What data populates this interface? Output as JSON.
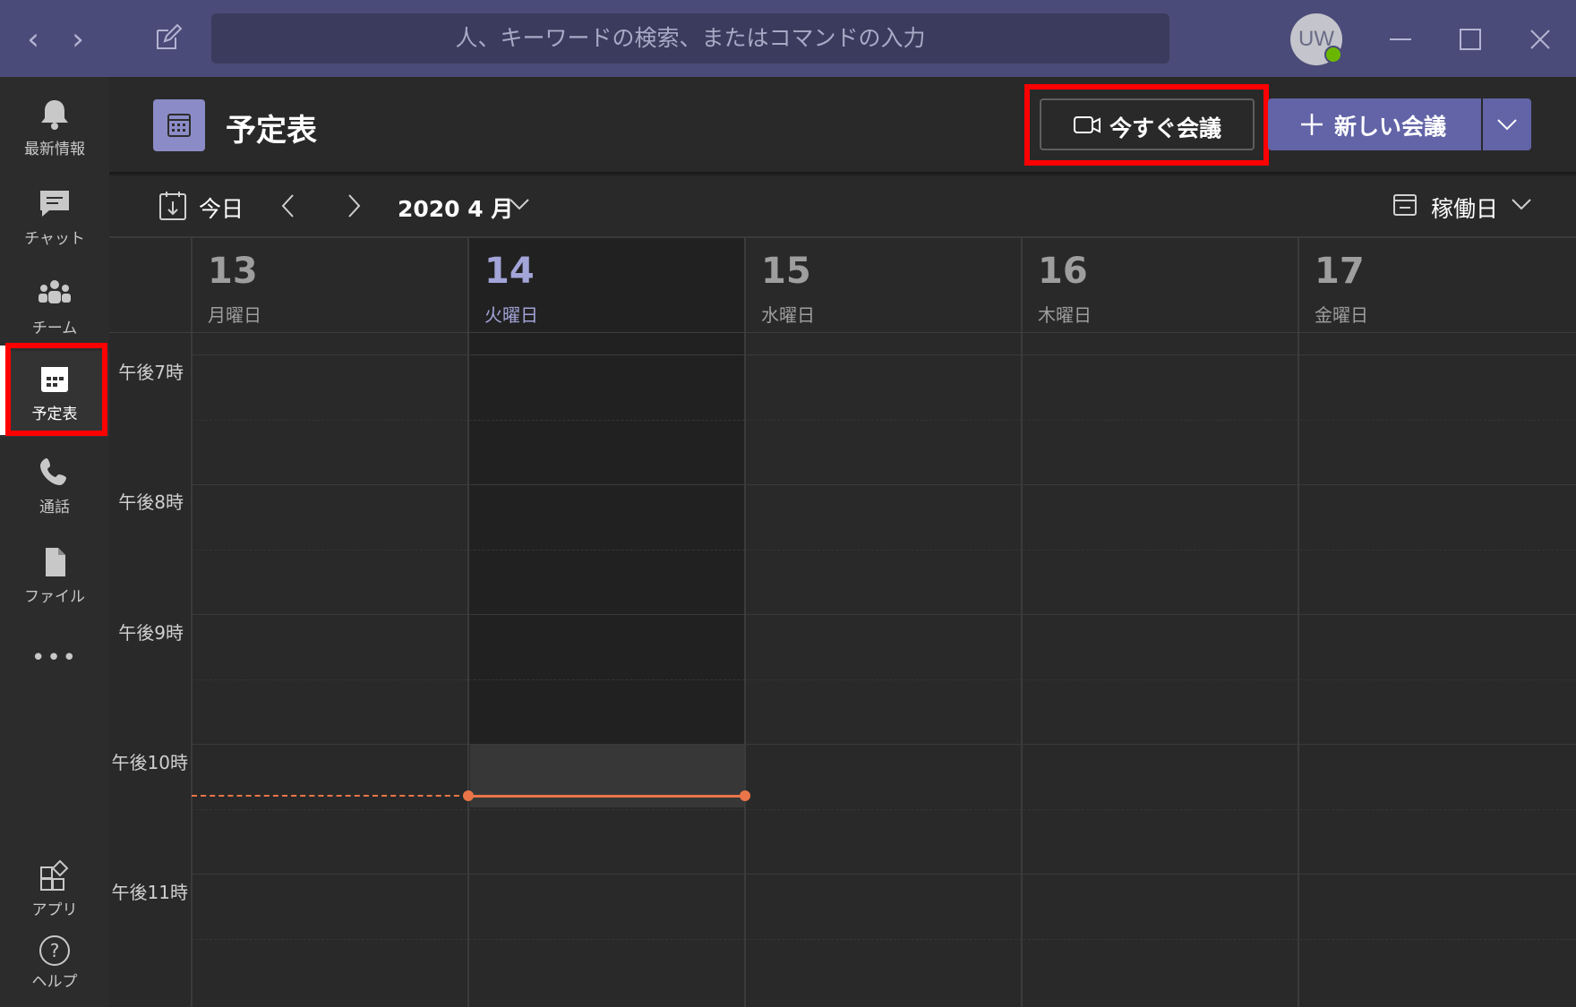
{
  "titlebar": {
    "search_placeholder": "人、キーワードの検索、またはコマンドの入力",
    "avatar_initials": "UW",
    "presence_color": "#6bb700"
  },
  "rail": {
    "items": [
      {
        "label": "最新情報",
        "icon": "bell-icon"
      },
      {
        "label": "チャット",
        "icon": "chat-icon"
      },
      {
        "label": "チーム",
        "icon": "teams-icon"
      },
      {
        "label": "予定表",
        "icon": "calendar-icon",
        "active": true
      },
      {
        "label": "通話",
        "icon": "phone-icon"
      },
      {
        "label": "ファイル",
        "icon": "file-icon"
      },
      {
        "label": "アプリ",
        "icon": "apps-icon"
      },
      {
        "label": "ヘルプ",
        "icon": "help-icon"
      }
    ],
    "more_label": "•••"
  },
  "header": {
    "title": "予定表",
    "meet_now_label": "今すぐ会議",
    "new_meeting_label": "新しい会議"
  },
  "toolbar": {
    "today_label": "今日",
    "month_label": "2020 4 月",
    "view_label": "稼働日"
  },
  "days": [
    {
      "num": "13",
      "name": "月曜日"
    },
    {
      "num": "14",
      "name": "火曜日",
      "today": true
    },
    {
      "num": "15",
      "name": "水曜日"
    },
    {
      "num": "16",
      "name": "木曜日"
    },
    {
      "num": "17",
      "name": "金曜日"
    }
  ],
  "times": [
    "午後7時",
    "午後8時",
    "午後9時",
    "午後10時",
    "午後11時"
  ],
  "colors": {
    "accent": "#6264a7",
    "current_time": "#e97548",
    "highlight": "#ff0000"
  }
}
